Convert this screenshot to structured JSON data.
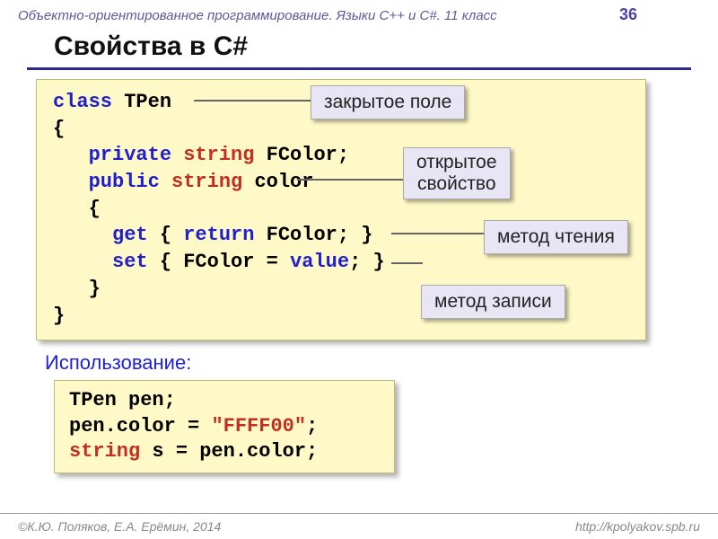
{
  "header": {
    "course": "Объектно-ориентированное программирование. Языки C++ и C#. 11 класс",
    "page": "36"
  },
  "title": "Свойства в C#",
  "code1": {
    "l1a": "class",
    "l1b": " TPen",
    "l2": "{",
    "l3a": "   private",
    "l3b": " string",
    "l3c": " FColor;",
    "l4a": "   public",
    "l4b": " string",
    "l4c": " color",
    "l5": "   {",
    "l6a": "     get",
    "l6b": " { ",
    "l6c": "return",
    "l6d": " FColor; }",
    "l7a": "     set",
    "l7b": " { FColor = ",
    "l7c": "value",
    "l7d": "; }",
    "l8": "   }",
    "l9": "}"
  },
  "callouts": {
    "c1": "закрытое поле",
    "c2_l1": "открытое",
    "c2_l2": "свойство",
    "c3": "метод чтения",
    "c4": "метод записи"
  },
  "usage_label": "Использование:",
  "code2": {
    "l1": "TPen pen;",
    "l2a": "pen.color = ",
    "l2b": "\"FFFF00\"",
    "l2c": ";",
    "l3a": "string",
    "l3b": " s = pen.color;"
  },
  "footer": {
    "left": "©К.Ю. Поляков, Е.А. Ерёмин, 2014",
    "right": "http://kpolyakov.spb.ru"
  }
}
